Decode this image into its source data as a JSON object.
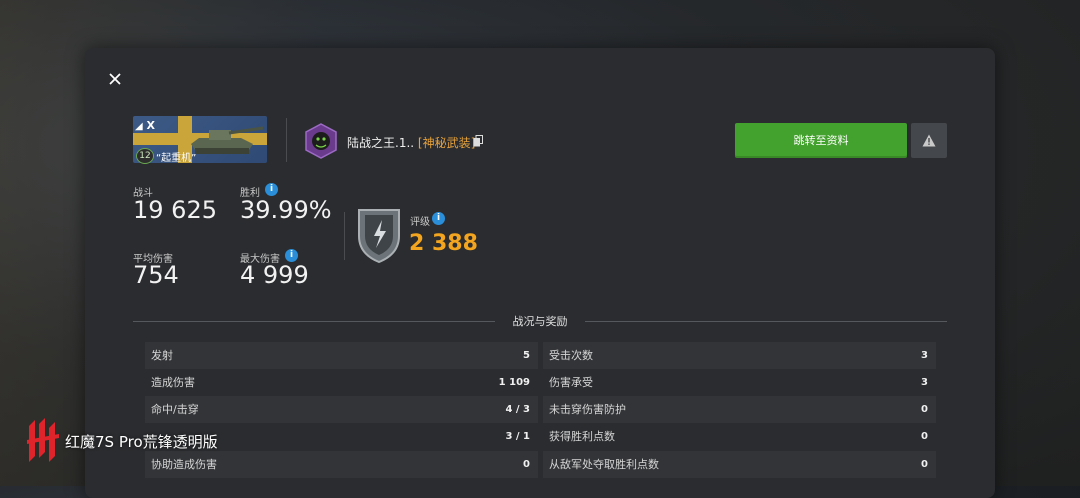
{
  "close_icon": "close-icon",
  "tank": {
    "tier_roman": "X",
    "level": "12",
    "name": "“起重机”",
    "flag_colors": {
      "blue": "#3d5a86",
      "gold": "#c9a53a"
    }
  },
  "player": {
    "name": "陆战之王.1..",
    "clan": "[神秘武装]"
  },
  "buttons": {
    "goto_profile": "跳转至资料",
    "report_icon": "warning-icon"
  },
  "stats": {
    "battles_label": "战斗",
    "battles_value": "19 625",
    "winrate_label": "胜利",
    "winrate_value": "39.99%",
    "avg_damage_label": "平均伤害",
    "avg_damage_value": "754",
    "max_damage_label": "最大伤害",
    "max_damage_value": "4 999",
    "rating_label": "评级",
    "rating_value": "2 388"
  },
  "section": {
    "title": "战况与奖励",
    "left_rows": [
      {
        "label": "发射",
        "value": "5"
      },
      {
        "label": "造成伤害",
        "value": "1 109"
      },
      {
        "label": "命中/击穿",
        "value": "4 / 3"
      },
      {
        "label": "",
        "value": "3 / 1"
      },
      {
        "label": "协助造成伤害",
        "value": "0"
      }
    ],
    "right_rows": [
      {
        "label": "受击次数",
        "value": "3"
      },
      {
        "label": "伤害承受",
        "value": "3"
      },
      {
        "label": "未击穿伤害防护",
        "value": "0"
      },
      {
        "label": "获得胜利点数",
        "value": "0"
      },
      {
        "label": "从敌军处夺取胜利点数",
        "value": "0"
      }
    ]
  },
  "watermark": {
    "text": "红魔7S Pro荒锋透明版"
  },
  "colors": {
    "accent_green": "#43a12d",
    "rating_orange": "#f4a51f",
    "clan_orange": "#e8a33d",
    "info_blue": "#2a8fd8",
    "panel": "#2a2c2f"
  }
}
